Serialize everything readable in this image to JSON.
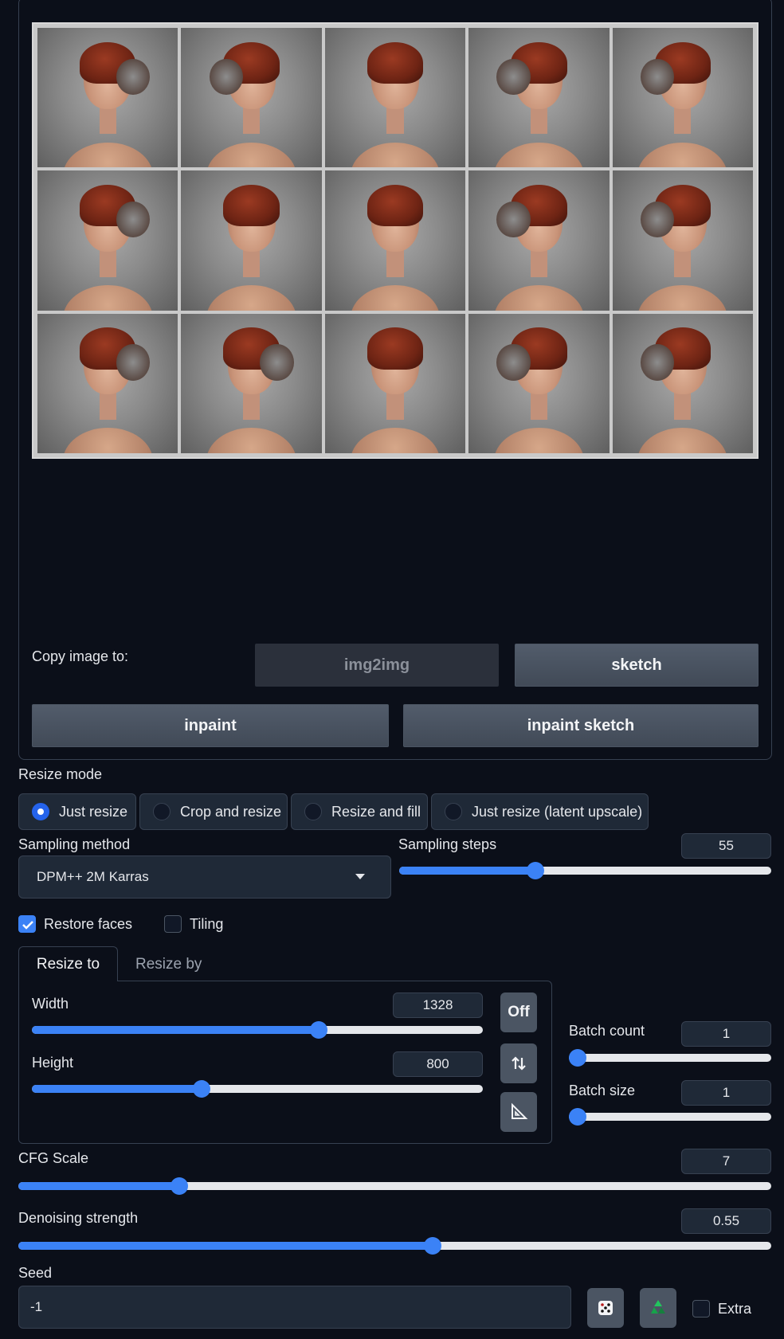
{
  "gallery": {
    "image_count": 15
  },
  "copy_image": {
    "label": "Copy image to:",
    "buttons": [
      "img2img",
      "sketch",
      "inpaint",
      "inpaint sketch"
    ]
  },
  "resize_mode": {
    "label": "Resize mode",
    "options": [
      "Just resize",
      "Crop and resize",
      "Resize and fill",
      "Just resize (latent upscale)"
    ],
    "selected": "Just resize"
  },
  "sampling": {
    "method_label": "Sampling method",
    "method_value": "DPM++ 2M Karras",
    "steps_label": "Sampling steps",
    "steps_value": "55",
    "steps_fraction": 0.367
  },
  "checks": {
    "restore_faces": "Restore faces",
    "restore_faces_checked": true,
    "tiling": "Tiling",
    "tiling_checked": false
  },
  "tabs": {
    "resize_to": "Resize to",
    "resize_by": "Resize by",
    "active": "Resize to"
  },
  "dimensions": {
    "width_label": "Width",
    "width_value": "1328",
    "width_fraction": 0.636,
    "height_label": "Height",
    "height_value": "800",
    "height_fraction": 0.377,
    "off_button": "Off"
  },
  "batch": {
    "count_label": "Batch count",
    "count_value": "1",
    "size_label": "Batch size",
    "size_value": "1"
  },
  "cfg": {
    "label": "CFG Scale",
    "value": "7",
    "fraction": 0.214
  },
  "denoising": {
    "label": "Denoising strength",
    "value": "0.55",
    "fraction": 0.55
  },
  "seed": {
    "label": "Seed",
    "value": "-1",
    "extra_label": "Extra"
  },
  "icons": {
    "dice": "dice-icon",
    "recycle": "recycle-icon",
    "swap": "swap-arrows-icon",
    "ratio": "ruler-triangle-icon",
    "dropdown": "caret-down-icon"
  }
}
